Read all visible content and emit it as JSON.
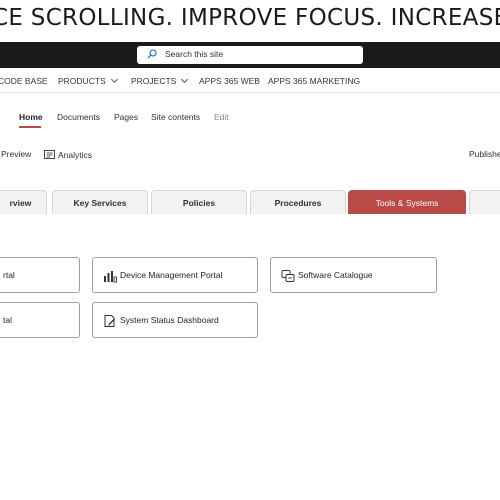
{
  "banner": {
    "text": "CE SCROLLING. IMPROVE FOCUS. INCREASE CLA"
  },
  "search": {
    "placeholder": "Search this site"
  },
  "hub_nav": {
    "items": [
      {
        "label": "CODE BASE"
      },
      {
        "label": "PRODUCTS"
      },
      {
        "label": "PROJECTS"
      },
      {
        "label": "APPS 365 WEB"
      },
      {
        "label": "APPS 365 MARKETING"
      }
    ]
  },
  "site_nav": {
    "items": [
      {
        "label": "Home"
      },
      {
        "label": "Documents"
      },
      {
        "label": "Pages"
      },
      {
        "label": "Site contents"
      },
      {
        "label": "Edit"
      }
    ]
  },
  "page_toolbar": {
    "preview": "Preview",
    "analytics": "Analytics",
    "published": "Published"
  },
  "tabs": [
    {
      "label": "rview"
    },
    {
      "label": "Key Services"
    },
    {
      "label": "Policies"
    },
    {
      "label": "Procedures"
    },
    {
      "label": "Tools & Systems"
    }
  ],
  "cards": [
    {
      "label": "rtal",
      "icon": "none"
    },
    {
      "label": "Device Management Portal",
      "icon": "device-bars-icon"
    },
    {
      "label": "Software Catalogue",
      "icon": "software-catalogue-icon"
    },
    {
      "label": "tal",
      "icon": "none"
    },
    {
      "label": "System Status Dashboard",
      "icon": "document-edit-icon"
    }
  ],
  "colors": {
    "accent": "#b94a48",
    "topbar": "#1a1a1a",
    "tab_bg": "#f3f2f1"
  }
}
